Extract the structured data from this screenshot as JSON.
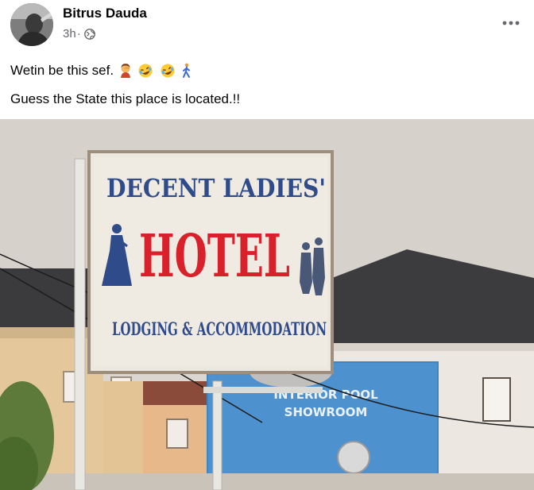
{
  "post": {
    "author": "Bitrus Dauda",
    "time": "3h",
    "separator": "·",
    "audience_icon": "globe-icon",
    "more_icon": "more-horizontal-icon",
    "lines": [
      "Wetin be this sef.",
      "Guess the State this place is located.!!"
    ],
    "emojis": [
      "woman-facepalming-emoji",
      "rolling-on-floor-laughing-emoji",
      "rolling-on-floor-laughing-emoji",
      "person-walking-emoji"
    ]
  },
  "photo": {
    "sign": {
      "line1": "DECENT LADIES'",
      "line2": "HOTEL",
      "line3": "LODGING & ACCOMMODATION"
    },
    "background_sign": {
      "line1": "INTERIOR POOL",
      "line2": "SHOWROOM"
    },
    "colors": {
      "sky": "#d9d3cd",
      "sign_face": "#ece8e0",
      "sign_blue": "#2f4b8a",
      "sign_red": "#d8212a",
      "roof": "#3e3e40",
      "wall": "#e2c79a"
    }
  }
}
